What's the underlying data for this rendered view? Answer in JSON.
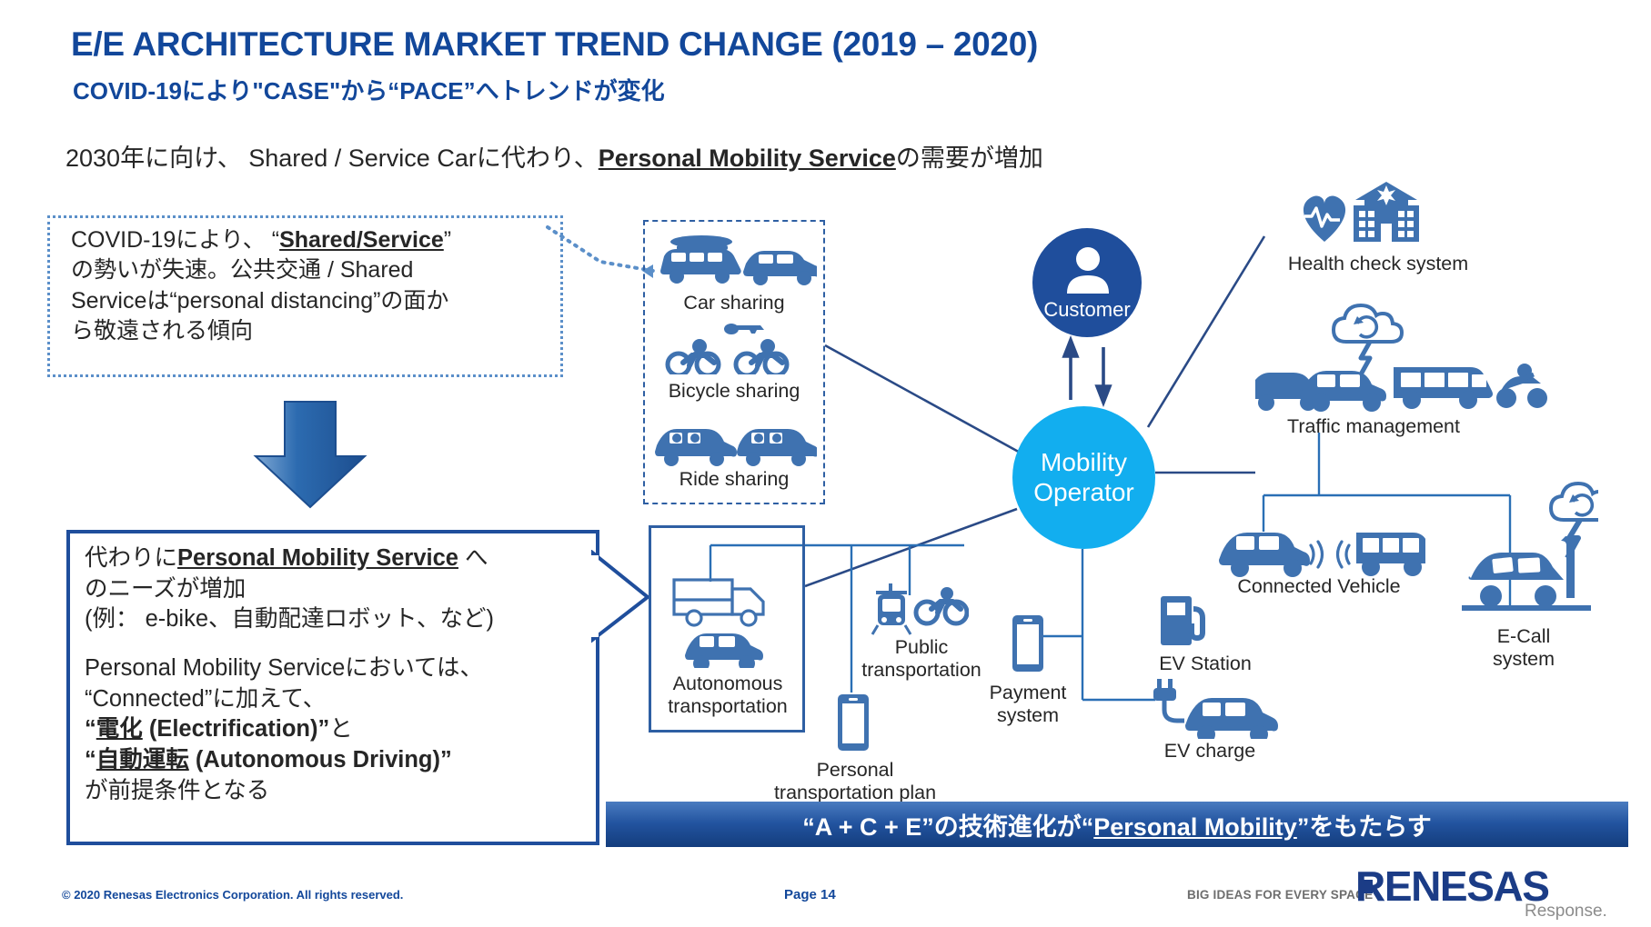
{
  "title": {
    "main": "E/E ARCHITECTURE MARKET TREND CHANGE (2019 – 2020)",
    "sub": "COVID-19により\"CASE\"から“PACE”へトレンドが変化"
  },
  "lead": {
    "before": "2030年に向け、 Shared / Service Carに代わり、",
    "emphasis": "Personal Mobility Service",
    "after": "の需要が増加"
  },
  "note_box": {
    "line1_before": "COVID-19により、 “",
    "line1_emphasis": "Shared/Service",
    "line1_after": "”",
    "line2": "の勢いが失速。公共交通 / Shared",
    "line3": "Serviceは“personal distancing”の面か",
    "line4": "ら敬遠される傾向"
  },
  "callout": {
    "l1_before": "代わりに",
    "l1_emphasis": "Personal Mobility Service",
    "l1_after": " へ",
    "l2": "のニーズが増加",
    "l3": "(例： e-bike、自動配達ロボット、など)",
    "l4": "Personal Mobility Serviceにおいては、",
    "l5": "“Connected”に加えて、",
    "l6_q1": "“",
    "l6_u": "電化",
    "l6_rest": " (Electrification)”",
    "l6_tail": "と",
    "l7_q1": "“",
    "l7_u": "自動運転",
    "l7_rest": " (Autonomous Driving)”",
    "l8": "が前提条件となる"
  },
  "diagram": {
    "shared_group": {
      "items": [
        {
          "label": "Car sharing",
          "icon": "van-and-car-icon"
        },
        {
          "label": "Bicycle sharing",
          "icon": "two-cyclists-icon"
        },
        {
          "label": "Ride sharing",
          "icon": "two-cars-with-passengers-icon"
        }
      ]
    },
    "autonomous_group": {
      "label": "Autonomous\ntransportation",
      "label_line1": "Autonomous",
      "label_line2": "transportation",
      "icon": "truck-and-car-icon"
    },
    "customer": {
      "label": "Customer",
      "icon": "person-icon",
      "color": "#1F4E9C"
    },
    "mobility_operator": {
      "line1": "Mobility",
      "line2": "Operator",
      "color": "#12AEEF"
    },
    "nodes": [
      {
        "id": "health-check",
        "label_line1": "Health check system",
        "icon": "heartbeat-and-hospital-icon"
      },
      {
        "id": "traffic-management",
        "label_line1": "Traffic management",
        "icon": "cloud-cars-bus-motorcycle-icon"
      },
      {
        "id": "connected-vehicle",
        "label_line1": "Connected Vehicle",
        "icon": "car-bus-wifi-icon"
      },
      {
        "id": "ecall-system",
        "label_line1": "E-Call",
        "label_line2": "system",
        "icon": "crashed-car-pole-cloud-icon"
      },
      {
        "id": "ev-station",
        "label_line1": "EV Station",
        "icon": "fuel-pump-icon"
      },
      {
        "id": "ev-charge",
        "label_line1": "EV charge",
        "icon": "car-with-plug-icon"
      },
      {
        "id": "payment-system",
        "label_line1": "Payment",
        "label_line2": "system",
        "icon": "smartphone-icon"
      },
      {
        "id": "public-transportation",
        "label_line1": "Public",
        "label_line2": "transportation",
        "icon": "tram-and-cyclist-icon"
      },
      {
        "id": "personal-transportation-plan",
        "label_line1": "Personal",
        "label_line2": "transportation plan",
        "icon": "smartphone-icon"
      }
    ]
  },
  "banner": {
    "before": "“A + C + E”の技術進化が“",
    "underlined": "Personal Mobility",
    "after": "”をもたらす"
  },
  "footer": {
    "copyright": "© 2020 Renesas Electronics Corporation. All rights reserved.",
    "page": "Page 14",
    "tagline": "BIG IDEAS FOR EVERY SPACE",
    "logo": "RENESAS",
    "logo_sub": "Response."
  },
  "colors": {
    "brand_blue": "#12479A",
    "icon_blue": "#3F72B0",
    "cyan": "#12AEEF",
    "dark_blue": "#1F4E9C"
  }
}
